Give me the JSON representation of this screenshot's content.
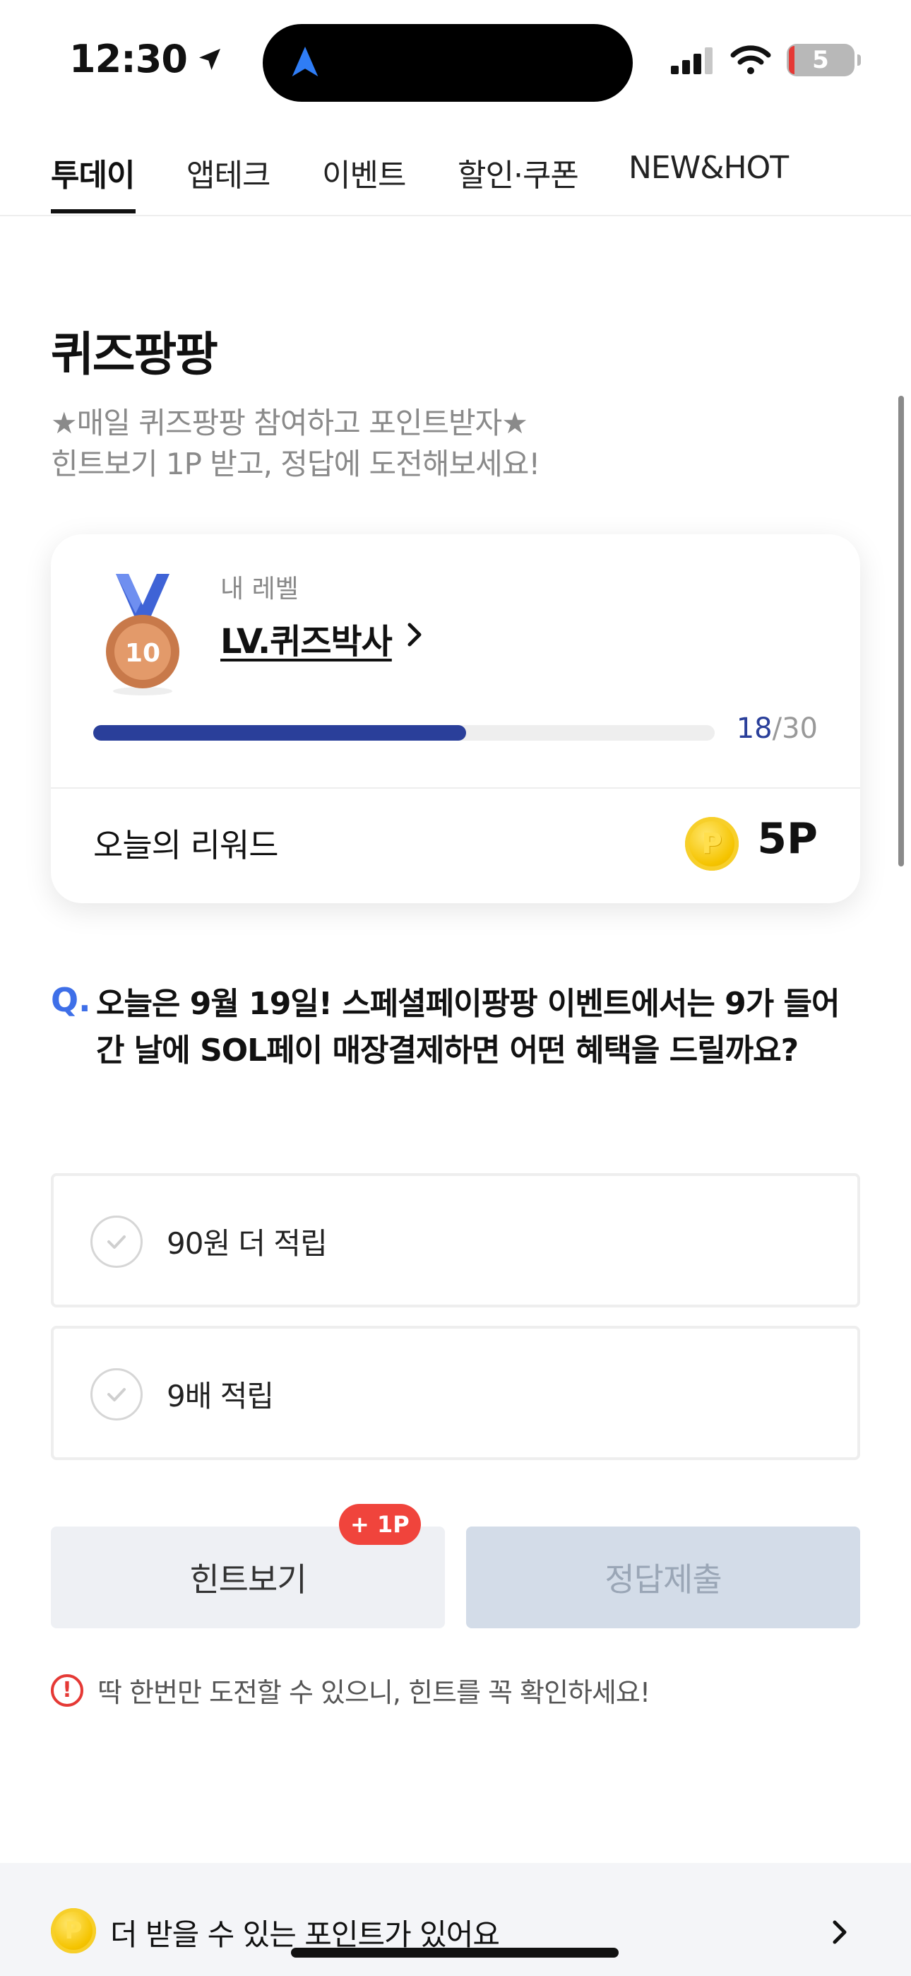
{
  "status_bar": {
    "time": "12:30",
    "battery": "5"
  },
  "tabs": [
    {
      "label": "투데이",
      "active": true
    },
    {
      "label": "앱테크",
      "active": false
    },
    {
      "label": "이벤트",
      "active": false
    },
    {
      "label": "할인·쿠폰",
      "active": false
    },
    {
      "label": "NEW&HOT",
      "active": false
    }
  ],
  "page": {
    "title": "퀴즈팡팡",
    "desc_line1": "★매일 퀴즈팡팡 참여하고 포인트받자★",
    "desc_line2": "힌트보기 1P 받고, 정답에 도전해보세요!"
  },
  "level_card": {
    "medal_number": "10",
    "label": "내 레벨",
    "name": "LV.퀴즈박사",
    "progress_current": "18",
    "progress_sep": "/",
    "progress_max": "30",
    "progress_fraction": 0.6,
    "reward_label": "오늘의 리워드",
    "coin_glyph": "P",
    "reward_value": "5P"
  },
  "question": {
    "mark": "Q.",
    "text": "오늘은 9월 19일! 스페셜페이팡팡 이벤트에서는 9가 들어간 날에 SOL페이 매장결제하면 어떤 혜택을 드릴까요?"
  },
  "options": [
    {
      "label": "90원 더 적립"
    },
    {
      "label": "9배 적립"
    }
  ],
  "buttons": {
    "hint": "힌트보기",
    "hint_badge": "+ 1P",
    "submit": "정답제출"
  },
  "warning": {
    "icon": "!",
    "text": "딱 한번만 도전할 수 있으니, 힌트를 꼭 확인하세요!"
  },
  "banner": {
    "coin_glyph": "P",
    "text": "더 받을 수 있는 포인트가 있어요"
  },
  "colors": {
    "accent_blue": "#2a3f9a",
    "question_blue": "#3e6fe8",
    "badge_red": "#f0443c"
  }
}
